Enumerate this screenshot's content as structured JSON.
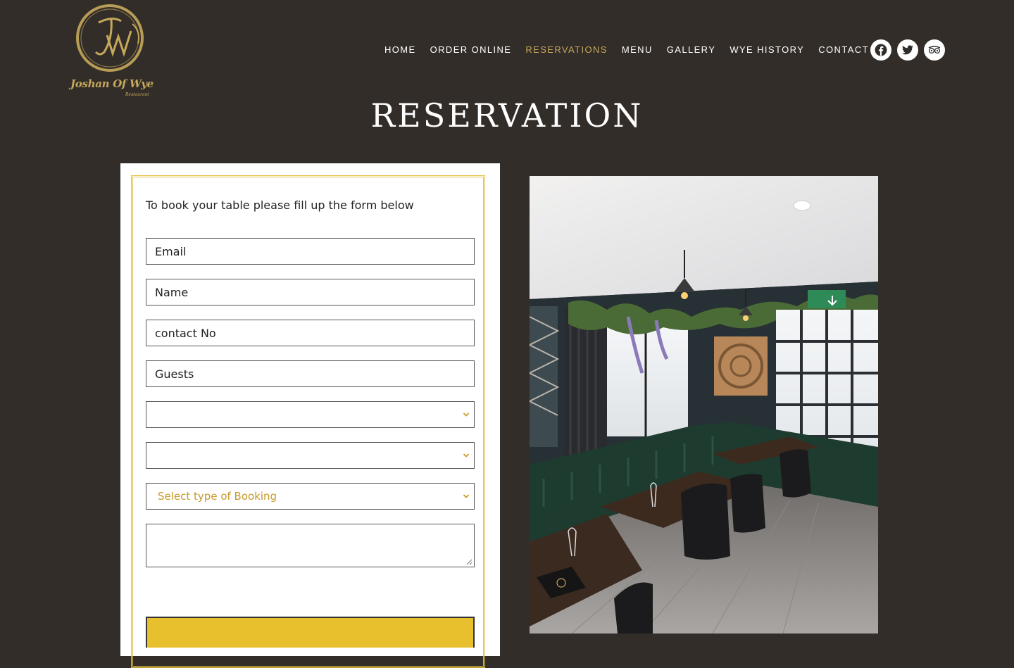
{
  "brand": {
    "monogram": "JW",
    "name": "Joshan Of Wye",
    "tagline": "Restaurant",
    "gold": "#c5a85a"
  },
  "nav": {
    "items": [
      "HOME",
      "ORDER ONLINE",
      "RESERVATIONS",
      "MENU",
      "GALLERY",
      "WYE HISTORY",
      "CONTACT"
    ],
    "active": "RESERVATIONS"
  },
  "social": [
    "facebook-icon",
    "twitter-icon",
    "tripadvisor-icon"
  ],
  "page": {
    "title": "RESERVATION",
    "background": "#322d29"
  },
  "form": {
    "intro": "To book your table please fill up the form below",
    "email_placeholder": "Email",
    "name_placeholder": "Name",
    "contact_placeholder": "contact No",
    "guests_placeholder": "Guests",
    "date_value": "",
    "time_value": "",
    "booking_type": "Select type of Booking",
    "message_value": "",
    "submit_label": "",
    "accent": "#e8c02e"
  }
}
